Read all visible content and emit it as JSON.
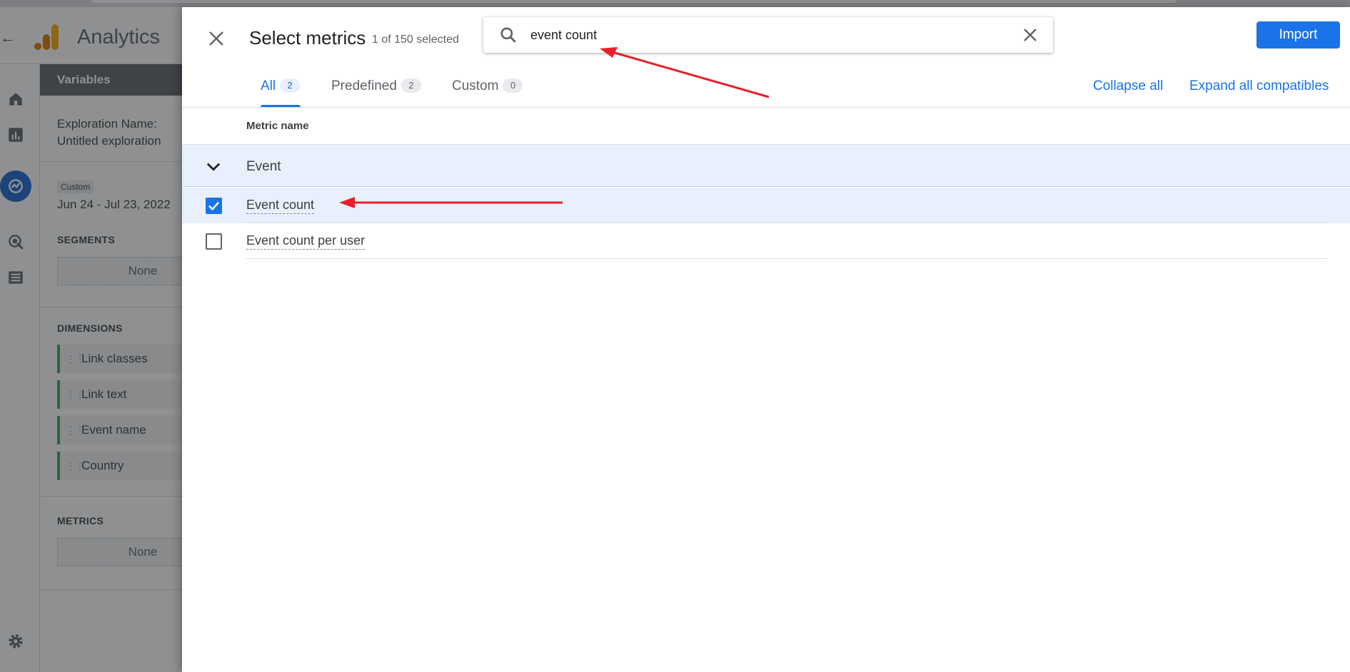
{
  "app": {
    "title": "Analytics",
    "variables_header": "Variables",
    "exploration_name_label": "Exploration Name:",
    "exploration_name_value": "Untitled exploration",
    "date_badge": "Custom",
    "date_range": "Jun 24 - Jul 23, 2022",
    "segments_label": "SEGMENTS",
    "segments_value": "None",
    "dimensions_label": "DIMENSIONS",
    "dimensions": [
      "Link classes",
      "Link text",
      "Event name",
      "Country"
    ],
    "metrics_label": "METRICS",
    "metrics_value": "None",
    "rail_icons": [
      "home-icon",
      "reports-icon",
      "explore-icon",
      "advertising-icon",
      "list-icon",
      "settings-icon"
    ]
  },
  "dialog": {
    "title": "Select metrics",
    "subtitle": "1 of 150 selected",
    "search": {
      "value": "event count",
      "placeholder": ""
    },
    "import_label": "Import",
    "tabs": [
      {
        "label": "All",
        "count": "2",
        "active": true
      },
      {
        "label": "Predefined",
        "count": "2",
        "active": false
      },
      {
        "label": "Custom",
        "count": "0",
        "active": false
      }
    ],
    "collapse_all": "Collapse all",
    "expand_all": "Expand all compatibles",
    "column_header": "Metric name",
    "group": "Event",
    "metrics": [
      {
        "label": "Event count",
        "checked": true
      },
      {
        "label": "Event count per user",
        "checked": false
      }
    ]
  },
  "colors": {
    "accent": "#1a73e8",
    "annotation_arrow": "#e8202a",
    "dimension_chip": "#34a853",
    "ga_logo_orange": "#f9ab00",
    "ga_logo_dark": "#e37400"
  }
}
